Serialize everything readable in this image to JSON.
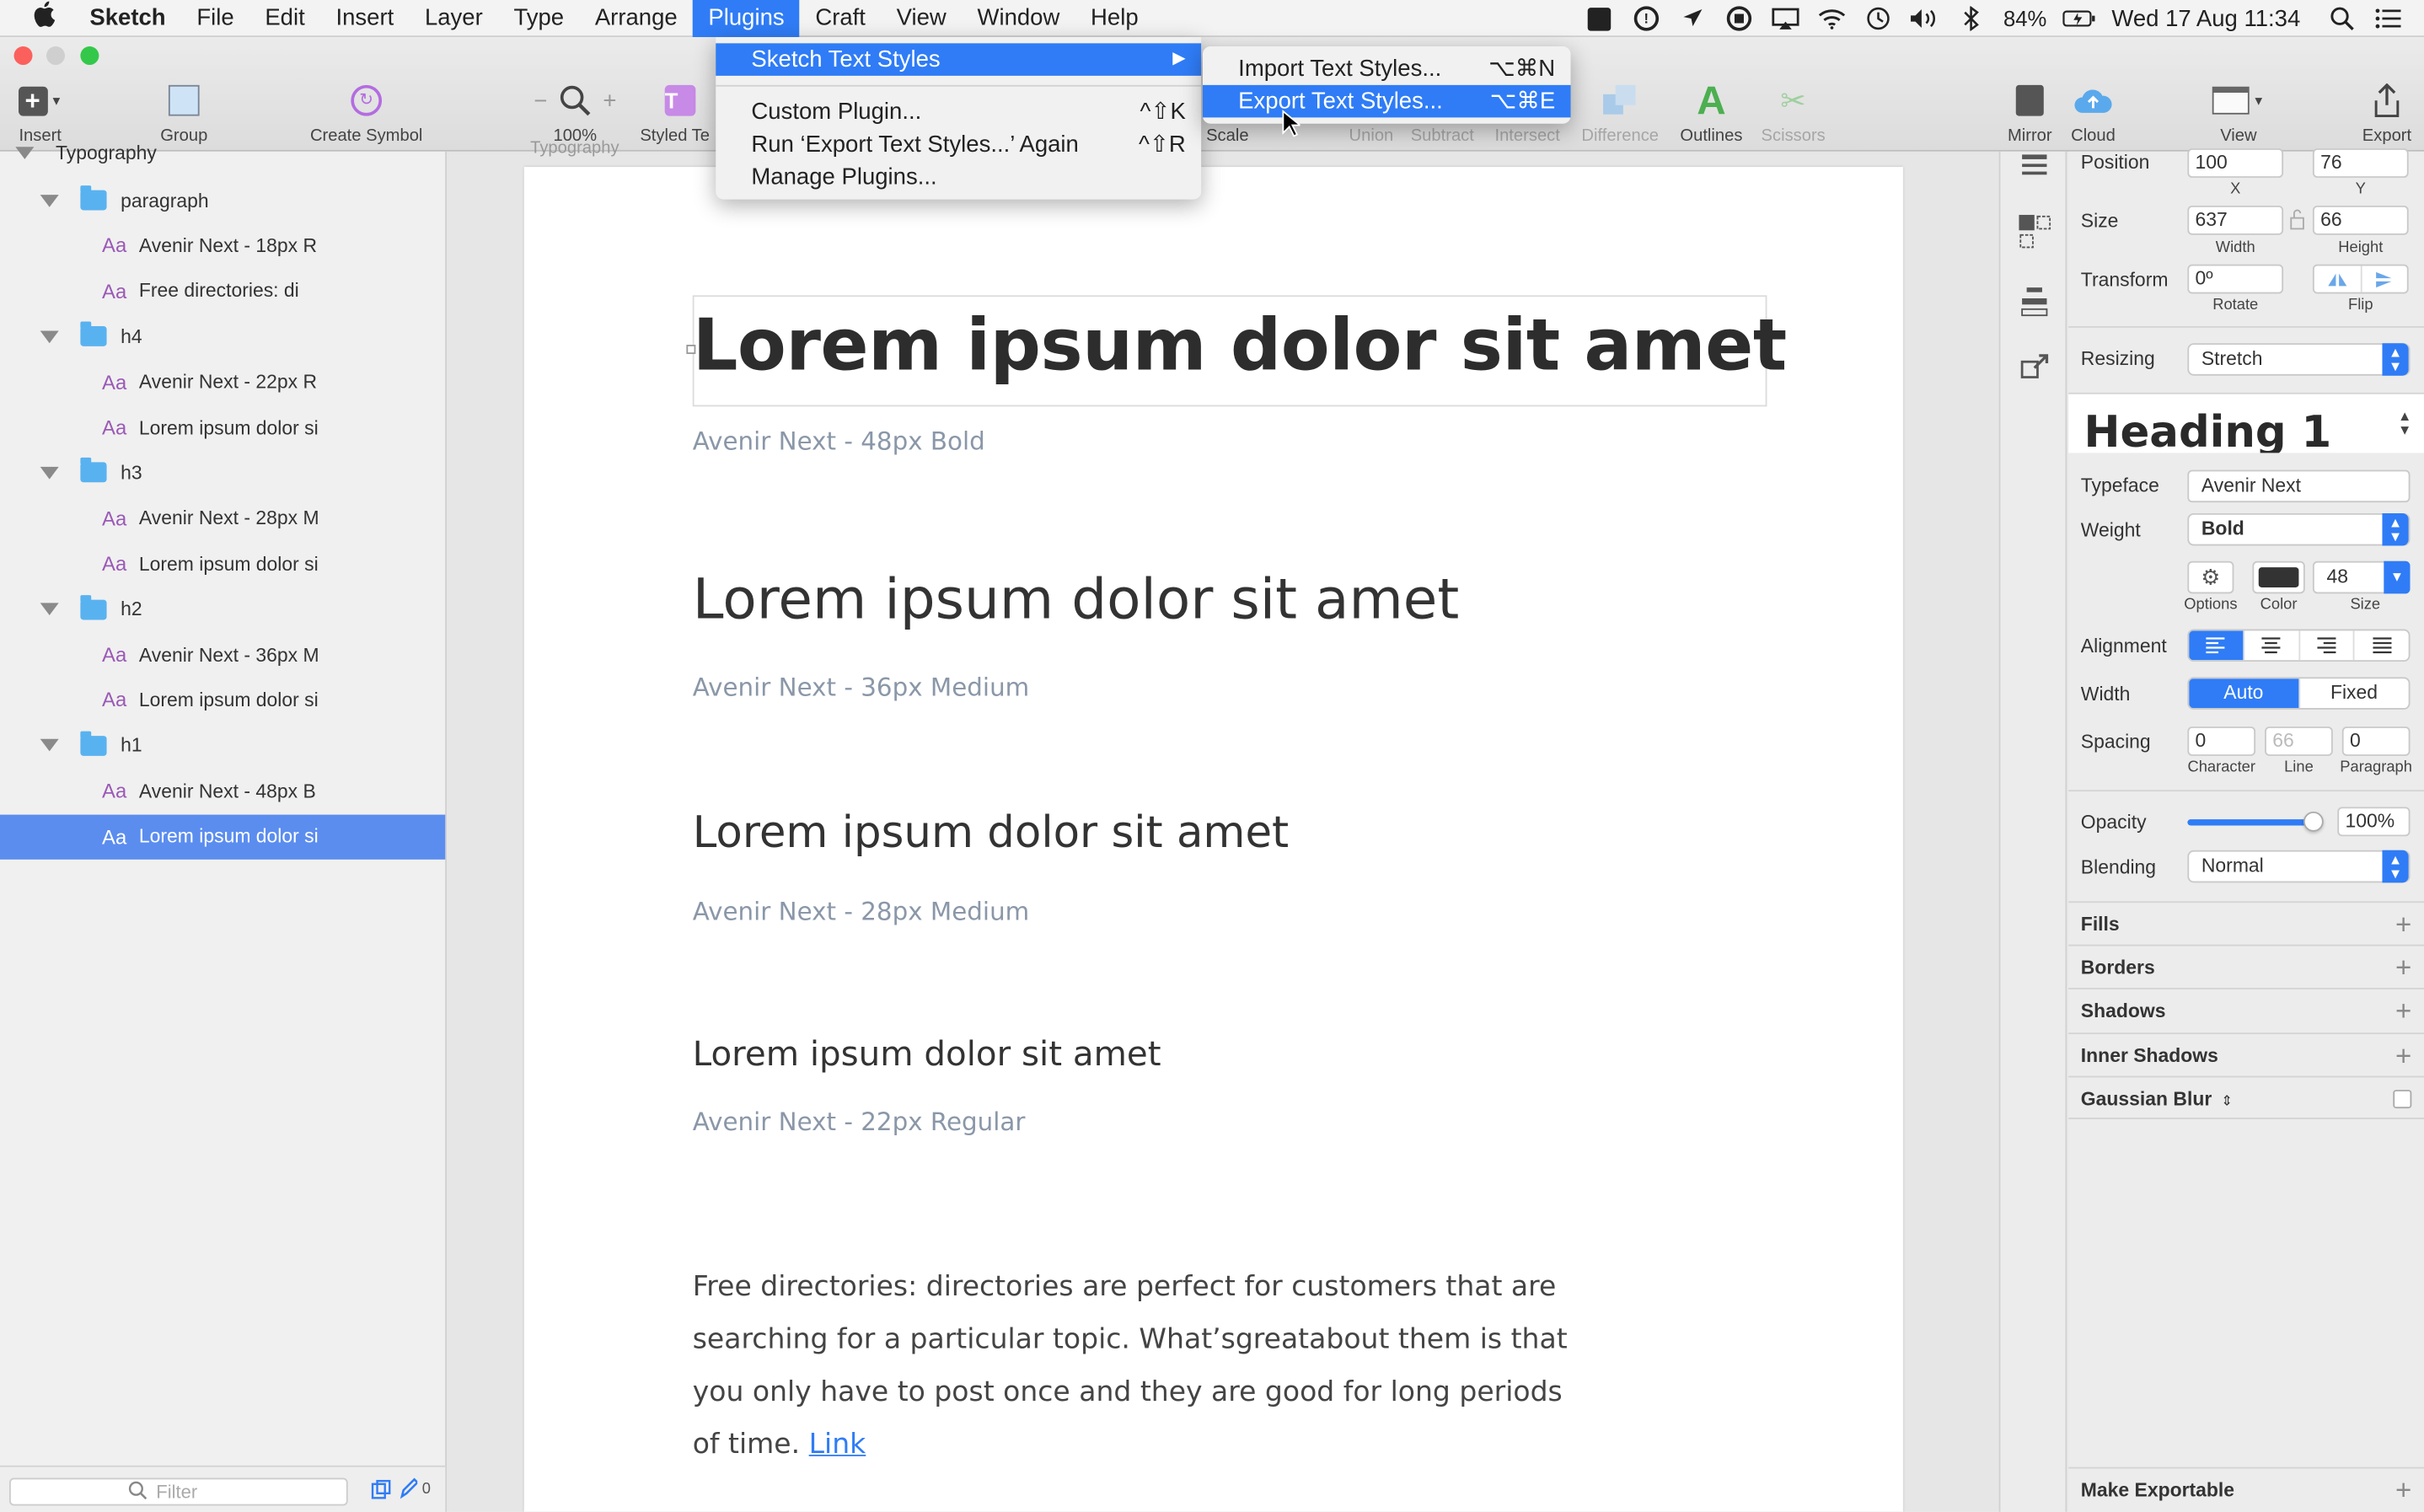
{
  "menubar": {
    "app": "Sketch",
    "items": [
      "File",
      "Edit",
      "Insert",
      "Layer",
      "Type",
      "Arrange",
      "Plugins",
      "Craft",
      "View",
      "Window",
      "Help"
    ],
    "battery": "84%",
    "clock": "Wed 17 Aug  11:34"
  },
  "toolbar": {
    "insert": "Insert",
    "group": "Group",
    "create_symbol": "Create Symbol",
    "zoom": "100%",
    "zoom_minus": "−",
    "zoom_plus": "+",
    "styled_text": "Styled Te",
    "scale": "Scale",
    "union": "Union",
    "subtract": "Subtract",
    "intersect": "Intersect",
    "difference": "Difference",
    "outlines": "Outlines",
    "scissors": "Scissors",
    "mirror": "Mirror",
    "cloud": "Cloud",
    "view": "View",
    "export": "Export"
  },
  "plugins_menu": {
    "items": [
      {
        "label": "Sketch Text Styles",
        "shortcut": "▶"
      },
      {
        "label": "Custom Plugin...",
        "shortcut": "^⇧K"
      },
      {
        "label": "Run ‘Export Text Styles...’ Again",
        "shortcut": "^⇧R"
      },
      {
        "label": "Manage Plugins...",
        "shortcut": ""
      }
    ]
  },
  "submenu": {
    "items": [
      {
        "label": "Import Text Styles...",
        "shortcut": "⌥⌘N"
      },
      {
        "label": "Export Text Styles...",
        "shortcut": "⌥⌘E"
      }
    ]
  },
  "layers": {
    "root": "Typography",
    "rows": [
      {
        "type": "group",
        "label": "paragraph"
      },
      {
        "type": "text",
        "label": "Avenir Next - 18px R"
      },
      {
        "type": "text",
        "label": "Free directories: di"
      },
      {
        "type": "group",
        "label": "h4"
      },
      {
        "type": "text",
        "label": "Avenir Next - 22px R"
      },
      {
        "type": "text",
        "label": "Lorem ipsum dolor si"
      },
      {
        "type": "group",
        "label": "h3"
      },
      {
        "type": "text",
        "label": "Avenir Next - 28px M"
      },
      {
        "type": "text",
        "label": "Lorem ipsum dolor si"
      },
      {
        "type": "group",
        "label": "h2"
      },
      {
        "type": "text",
        "label": "Avenir Next - 36px M"
      },
      {
        "type": "text",
        "label": "Lorem ipsum dolor si"
      },
      {
        "type": "group",
        "label": "h1"
      },
      {
        "type": "text",
        "label": "Avenir Next - 48px B"
      },
      {
        "type": "text",
        "label": "Lorem ipsum dolor si",
        "selected": true
      }
    ],
    "aa": "Aa",
    "filter_placeholder": "Filter",
    "count": "0"
  },
  "canvas": {
    "artboard_label": "Typography",
    "h1": "Lorem ipsum dolor sit amet",
    "h1_caption": "Avenir Next - 48px Bold",
    "h2": "Lorem ipsum dolor sit amet",
    "h2_caption": "Avenir Next - 36px Medium",
    "h3": "Lorem ipsum dolor sit amet",
    "h3_caption": "Avenir Next - 28px Medium",
    "h4": "Lorem ipsum dolor sit amet",
    "h4_caption": "Avenir Next - 22px Regular",
    "paragraph_lines": [
      "Free directories: directories are perfect for customers that are",
      "searching for a particular topic. What’sgreatabout them is that",
      "you only have to post once and they are good for long periods"
    ],
    "paragraph_last": "of time.",
    "link": "Link"
  },
  "inspector": {
    "position_label": "Position",
    "x": "100",
    "y": "76",
    "x_sub": "X",
    "y_sub": "Y",
    "size_label": "Size",
    "width": "637",
    "height": "66",
    "width_sub": "Width",
    "height_sub": "Height",
    "transform_label": "Transform",
    "rotate": "0º",
    "rotate_sub": "Rotate",
    "flip_sub": "Flip",
    "resizing_label": "Resizing",
    "resizing": "Stretch",
    "style_name": "Heading 1",
    "typeface_label": "Typeface",
    "typeface": "Avenir Next",
    "weight_label": "Weight",
    "weight": "Bold",
    "options_sub": "Options",
    "color_sub": "Color",
    "size_val": "48",
    "size_sub": "Size",
    "alignment_label": "Alignment",
    "width_label": "Width",
    "auto": "Auto",
    "fixed": "Fixed",
    "spacing_label": "Spacing",
    "character": "0",
    "line": "66",
    "paragraph": "0",
    "character_sub": "Character",
    "line_sub": "Line",
    "paragraph_sub": "Paragraph",
    "opacity_label": "Opacity",
    "opacity": "100%",
    "blending_label": "Blending",
    "blending": "Normal",
    "fills": "Fills",
    "borders": "Borders",
    "shadows": "Shadows",
    "inner_shadows": "Inner Shadows",
    "gaussian_blur": "Gaussian Blur",
    "make_exportable": "Make Exportable"
  },
  "colors": {
    "accent": "#2f7cf6",
    "selection": "#5b8def",
    "text_color": "#333333",
    "caption": "#8a97a8",
    "link": "#2f7cf6",
    "aa": "#9b59b6"
  }
}
